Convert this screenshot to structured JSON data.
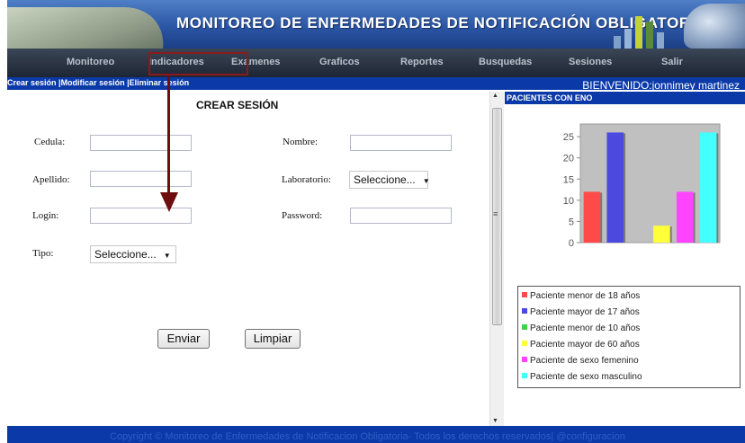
{
  "header": {
    "title": "MONITOREO DE ENFERMEDADES DE NOTIFICACIÓN OBLIGATORIA"
  },
  "nav": {
    "items": [
      {
        "label": "Monitoreo"
      },
      {
        "label": "Indicadores"
      },
      {
        "label": "Examenes"
      },
      {
        "label": "Graficos"
      },
      {
        "label": "Reportes"
      },
      {
        "label": "Busquedas"
      },
      {
        "label": "Sesiones"
      },
      {
        "label": "Salir"
      }
    ]
  },
  "subnav": {
    "links": [
      {
        "label": "Crear sesión"
      },
      {
        "label": "Modificar sesión"
      },
      {
        "label": "Eliminar sesión"
      }
    ],
    "sep": " |",
    "welcome": "BIENVENIDO:jonnimey martinez"
  },
  "form": {
    "title": "CREAR SESIÓN",
    "labels": {
      "cedula": "Cedula:",
      "nombre": "Nombre:",
      "apellido": "Apellido:",
      "laboratorio": "Laboratorio:",
      "login": "Login:",
      "password": "Password:",
      "tipo": "Tipo:"
    },
    "values": {
      "cedula": "",
      "nombre": "",
      "apellido": "",
      "login": "",
      "password": ""
    },
    "laboratorio_selected": "Seleccione...",
    "tipo_selected": "Seleccione...",
    "buttons": {
      "enviar": "Enviar",
      "limpiar": "Limpiar"
    }
  },
  "panel": {
    "title": "PACIENTES CON ENO"
  },
  "chart_data": {
    "type": "bar",
    "categories": [
      "Paciente menor de 18 años",
      "Paciente mayor de 17 años",
      "Paciente menor de 10 años",
      "Paciente mayor de 60 años",
      "Paciente de sexo femenino",
      "Paciente de sexo masculino"
    ],
    "values": [
      12,
      26,
      0,
      4,
      12,
      26
    ],
    "colors": [
      "#ff4a4a",
      "#4a4ae0",
      "#44d044",
      "#ffff3a",
      "#ff44ff",
      "#44ffff"
    ],
    "ylim": [
      0,
      28
    ],
    "yticks": [
      0,
      5,
      10,
      15,
      20,
      25
    ],
    "legend": [
      {
        "label": "Paciente menor de 18 años",
        "color": "#ff4a4a"
      },
      {
        "label": "Paciente mayor de 17 años",
        "color": "#4a4ae0"
      },
      {
        "label": "Paciente menor de 10 años",
        "color": "#44d044"
      },
      {
        "label": "Paciente mayor de 60 años",
        "color": "#ffff3a"
      },
      {
        "label": "Paciente de sexo femenino",
        "color": "#ff44ff"
      },
      {
        "label": "Paciente de sexo masculino",
        "color": "#44ffff"
      }
    ],
    "grid": false,
    "legend_position": "bottom"
  },
  "footer": {
    "text": "Copyright © Monitoreo de Enfermedades de Notificacion Obligatoria- Todos los derechos reservados| @configuracion"
  }
}
